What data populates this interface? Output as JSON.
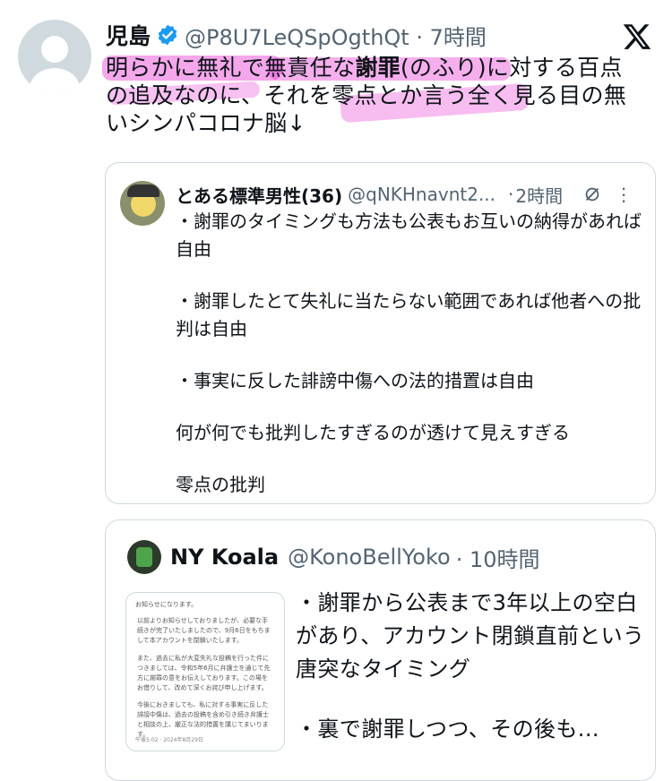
{
  "tweet": {
    "author_name": "児島",
    "handle_line": "@P8U7LeQSpOgthQt · 7時間",
    "text_segments": {
      "l1_a": "明らかに無礼で無責任な",
      "l1_b": "謝罪",
      "l1_c": "(のふり)に対する百点",
      "l2": "の追及なのに、それを零点とか言う全く見る目の無",
      "l3": "いシンパコロナ脳↓"
    }
  },
  "quote1": {
    "author_name": "とある標準男性(36)",
    "handle": "@qNKHnavnt2...",
    "time": "2時間",
    "dot": "·",
    "more_icon": "⋮",
    "paragraphs": [
      "・謝罪のタイミングも方法も公表もお互いの納得があれば自由",
      "・謝罪したとて失礼に当たらない範囲であれば他者への批判は自由",
      "・事実に反した誹謗中傷への法的措置は自由",
      "何が何でも批判したすぎるのが透けて見えすぎる",
      "零点の批判"
    ]
  },
  "quote2": {
    "author_name": "NY Koala",
    "handle": "@KonoBellYoko",
    "time": "· 10時間",
    "doc_image": {
      "title": "お知らせになります。",
      "p1": "以前よりお知らせしておりましたが、必要な手続きが完了いたしましたので、9月6日をもちまして本アカウントを閉鎖いたします。",
      "p2": "また、過去に私が大変失礼な投稿を行った件につきましては、令和5年6月に弁護士を通じて先方に謝罪の意をお伝えしております。この場をお借りして、改めて深くお詫び申し上げます。",
      "p3": "今後におきましても、私に対する事実に反した誹謗中傷は、過去の投稿を含め引き続き弁護士と相談の上、厳正な法的措置を講じてまいります。",
      "footer": "午後5:02 · 2024年8月29日"
    },
    "paragraphs": [
      "・謝罪から公表まで3年以上の空白があり、アカウント閉鎖直前という唐突なタイミング",
      "・裏で謝罪しつつ、その後も..."
    ]
  },
  "icons": {
    "verified": "verified-badge-icon",
    "brand": "x-logo-icon",
    "grok": "grok-icon",
    "more": "more-options-icon"
  },
  "colors": {
    "highlight": "#e63cd2",
    "verified": "#1d9bf0",
    "secondary_text": "#536471",
    "border": "#cfd9de"
  }
}
